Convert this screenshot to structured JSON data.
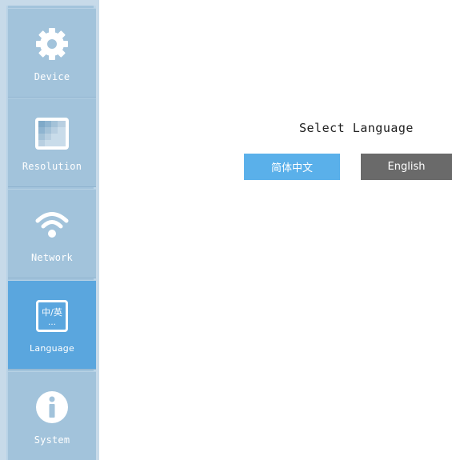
{
  "sidebar": {
    "items": [
      {
        "label": "Device",
        "icon": "gear-icon",
        "active": false
      },
      {
        "label": "Resolution",
        "icon": "resolution-icon",
        "active": false
      },
      {
        "label": "Network",
        "icon": "wifi-icon",
        "active": false
      },
      {
        "label": "Language",
        "icon": "language-icon",
        "icon_text": "中/英",
        "active": true
      },
      {
        "label": "System",
        "icon": "info-icon",
        "active": false
      }
    ]
  },
  "main": {
    "title": "Select Language",
    "buttons": {
      "chinese": "简体中文",
      "english": "English"
    }
  },
  "colors": {
    "sidebar": "#a2c3db",
    "active": "#5aa6de",
    "chinese_button": "#5ab0ea",
    "english_button": "#6a6a6a"
  }
}
